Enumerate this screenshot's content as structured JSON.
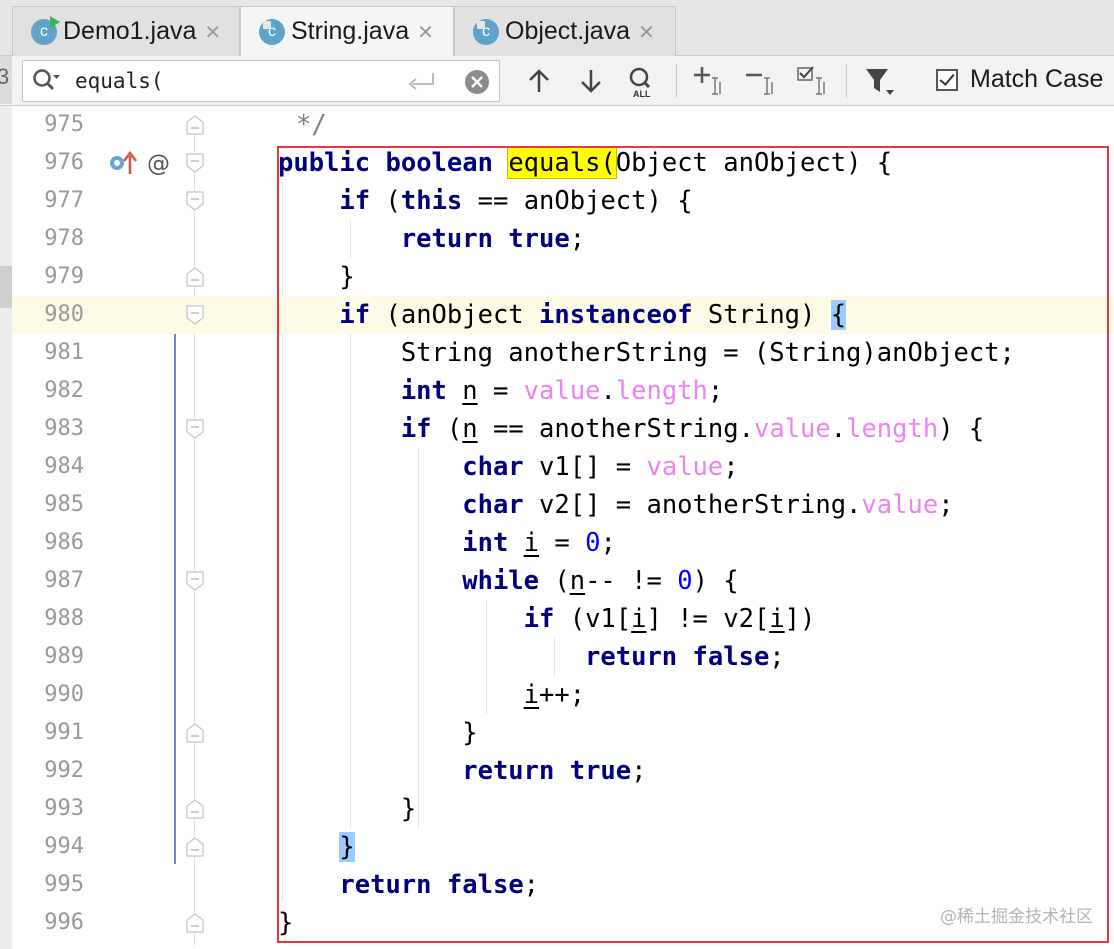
{
  "tabs": [
    {
      "label": "Demo1.java",
      "active": false,
      "icon": "class-run-icon"
    },
    {
      "label": "String.java",
      "active": true,
      "icon": "class-library-icon"
    },
    {
      "label": "Object.java",
      "active": false,
      "icon": "class-library-icon"
    }
  ],
  "search": {
    "query": "equals(",
    "match_case_label": "Match Case",
    "match_case_checked": true
  },
  "left_edge_char": "3",
  "editor": {
    "line_numbers": [
      "975",
      "976",
      "977",
      "978",
      "979",
      "980",
      "981",
      "982",
      "983",
      "984",
      "985",
      "986",
      "987",
      "988",
      "989",
      "990",
      "991",
      "992",
      "993",
      "994",
      "995",
      "996"
    ],
    "current_line": "980",
    "comment_tail": "*/"
  },
  "watermark": "@稀土掘金技术社区",
  "colors": {
    "keyword": "#000080",
    "field": "#ee82ee",
    "number": "#0000ff",
    "search_highlight": "#ffff00",
    "brace_match": "#99ccff",
    "annotation_box": "#e8383d"
  }
}
